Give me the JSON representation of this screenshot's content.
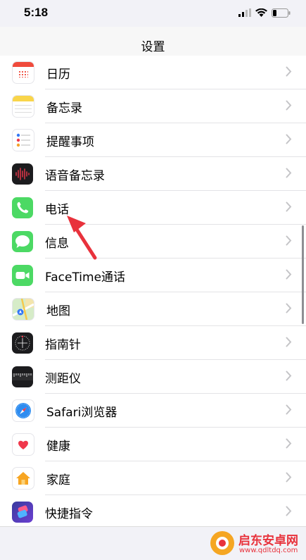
{
  "status": {
    "time": "5:18"
  },
  "nav": {
    "title": "设置"
  },
  "items": [
    {
      "label": "日历",
      "icon": "calendar-icon"
    },
    {
      "label": "备忘录",
      "icon": "notes-icon"
    },
    {
      "label": "提醒事项",
      "icon": "reminders-icon"
    },
    {
      "label": "语音备忘录",
      "icon": "voice-memos-icon"
    },
    {
      "label": "电话",
      "icon": "phone-icon"
    },
    {
      "label": "信息",
      "icon": "messages-icon"
    },
    {
      "label": "FaceTime通话",
      "icon": "facetime-icon"
    },
    {
      "label": "地图",
      "icon": "maps-icon"
    },
    {
      "label": "指南针",
      "icon": "compass-icon"
    },
    {
      "label": "测距仪",
      "icon": "measure-icon"
    },
    {
      "label": "Safari浏览器",
      "icon": "safari-icon"
    },
    {
      "label": "健康",
      "icon": "health-icon"
    },
    {
      "label": "家庭",
      "icon": "home-icon"
    },
    {
      "label": "快捷指令",
      "icon": "shortcuts-icon"
    }
  ],
  "watermark": {
    "name": "启东安卓网",
    "url": "www.qdltdq.com"
  },
  "colors": {
    "accent_arrow": "#e8323c",
    "chevron": "#c4c4c7"
  }
}
